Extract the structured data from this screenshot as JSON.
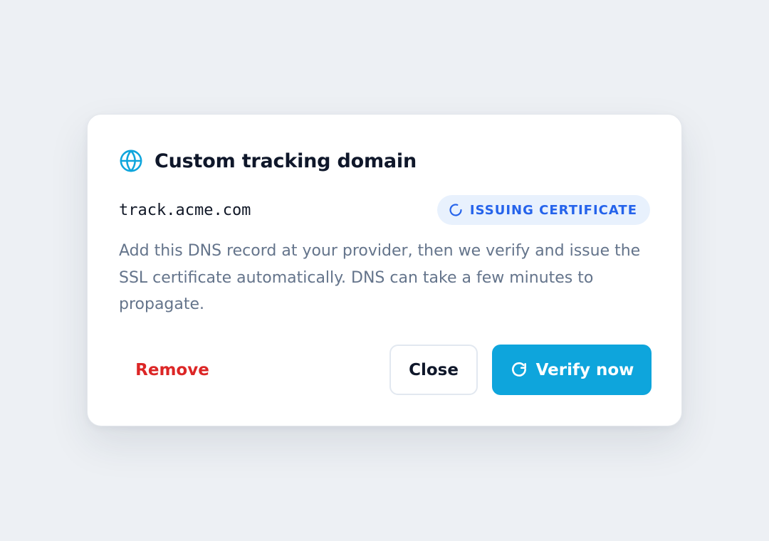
{
  "dialog": {
    "title": "Custom tracking domain",
    "title_icon": "globe-icon",
    "domain": "track.acme.com",
    "status": {
      "label": "ISSUING CERTIFICATE",
      "icon": "spinner-icon",
      "color": "#2563eb",
      "background": "#e8f1fd"
    },
    "description": "Add this DNS record at your provider, then we verify and issue the SSL certificate automatically. DNS can take a few minutes to propagate.",
    "actions": {
      "remove_label": "Remove",
      "close_label": "Close",
      "verify_label": "Verify now",
      "verify_icon": "refresh-icon"
    }
  },
  "colors": {
    "accent": "#0ea5dc",
    "danger": "#dc2626",
    "title": "#0f172a",
    "muted": "#64748b"
  }
}
